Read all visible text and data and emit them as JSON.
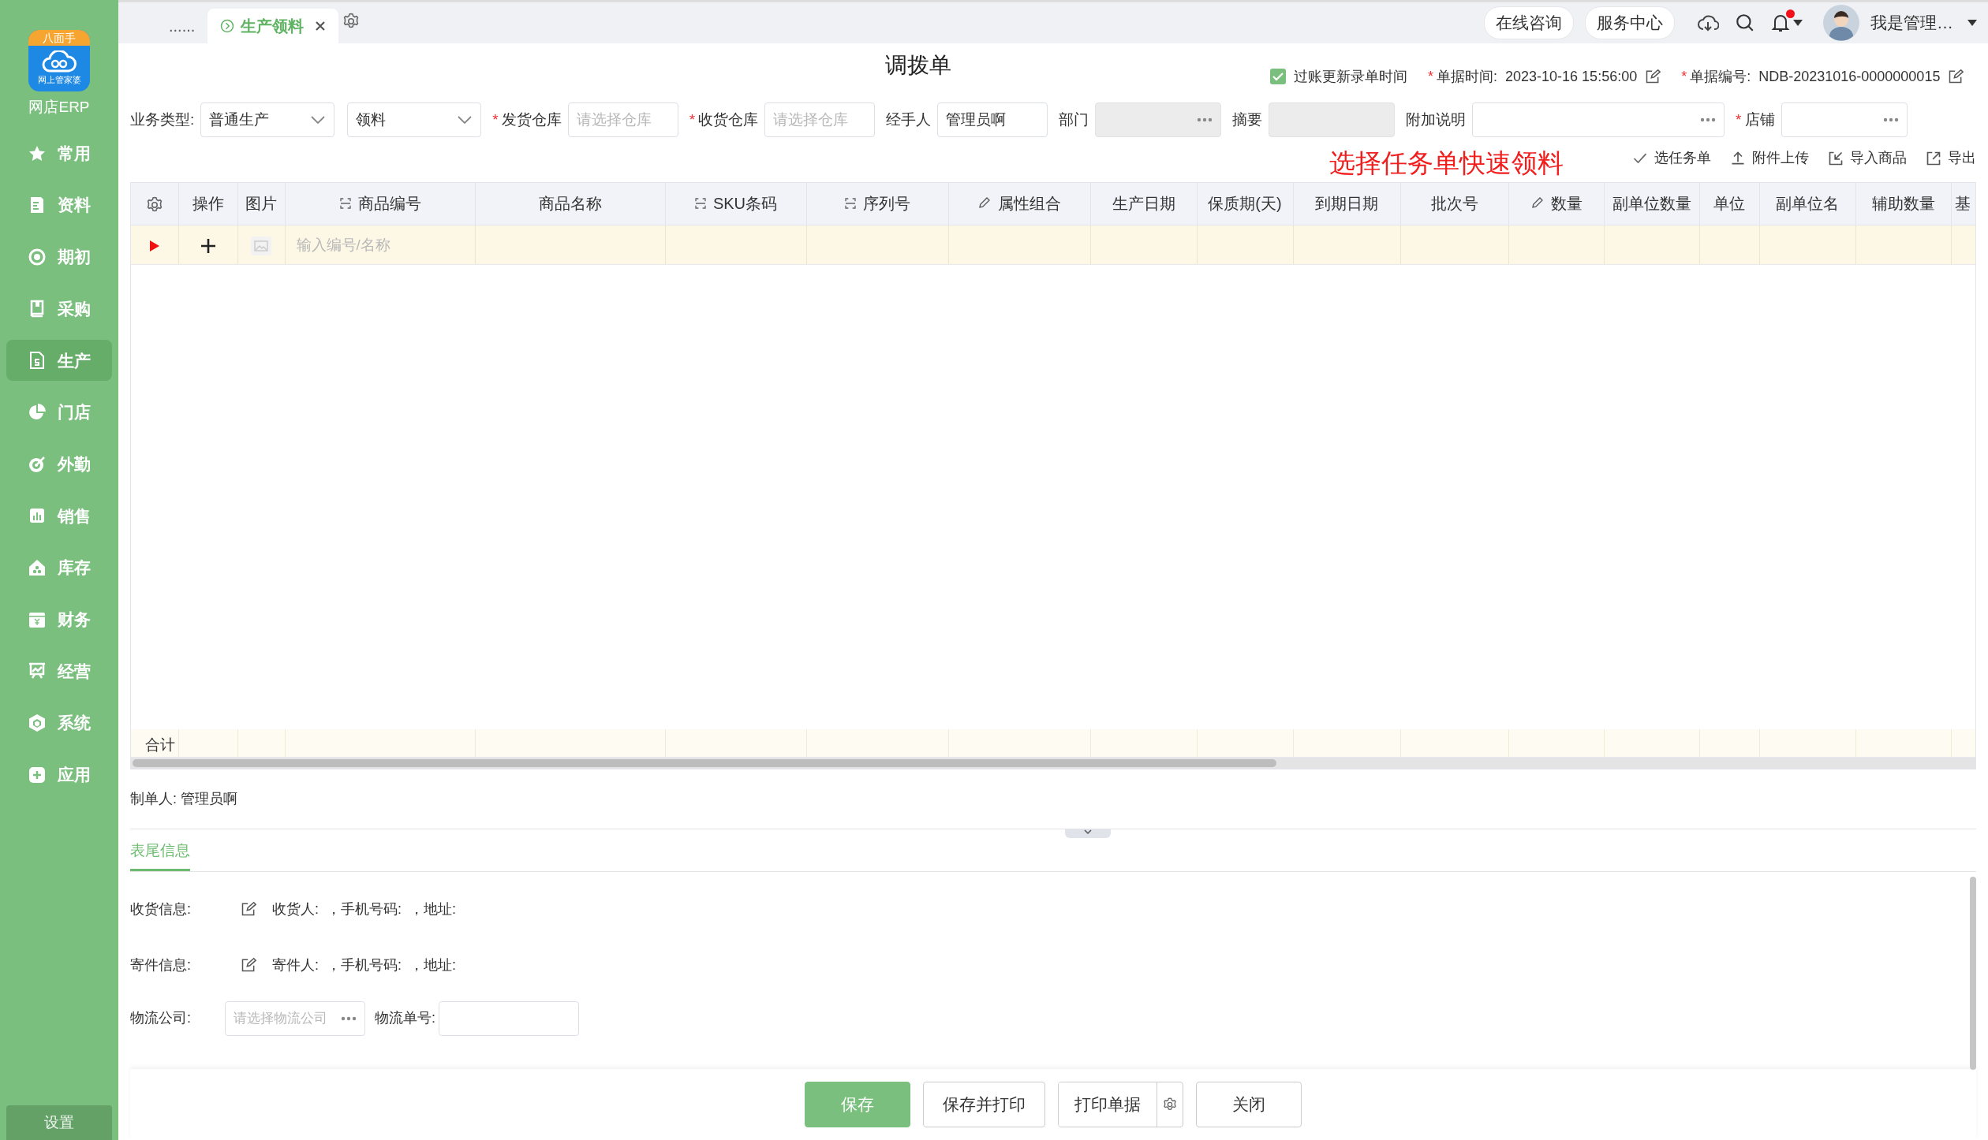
{
  "sidebar": {
    "logo_badge": "八面手",
    "logo_caption": "网上管家婆",
    "app_name": "网店ERP",
    "items": [
      {
        "label": "常用",
        "selected": false
      },
      {
        "label": "资料",
        "selected": false
      },
      {
        "label": "期初",
        "selected": false
      },
      {
        "label": "采购",
        "selected": false
      },
      {
        "label": "生产",
        "selected": true
      },
      {
        "label": "门店",
        "selected": false
      },
      {
        "label": "外勤",
        "selected": false
      },
      {
        "label": "销售",
        "selected": false
      },
      {
        "label": "库存",
        "selected": false
      },
      {
        "label": "财务",
        "selected": false
      },
      {
        "label": "经营",
        "selected": false
      },
      {
        "label": "系统",
        "selected": false
      },
      {
        "label": "应用",
        "selected": false
      }
    ],
    "settings": "设置"
  },
  "tabs": [
    {
      "label": "......",
      "selected": false
    },
    {
      "label": "生产领料",
      "selected": true
    }
  ],
  "header_links": [
    "在线咨询",
    "服务中心"
  ],
  "notifications": {
    "unread": true
  },
  "user": {
    "name": "我是管理…"
  },
  "form": {
    "title": "调拨单",
    "post_update": {
      "label": "过账更新录单时间",
      "checked": true
    },
    "meta": [
      {
        "required_mark": "*",
        "label": "单据时间:",
        "value": "2023-10-16 15:56:00"
      },
      {
        "required_mark": "*",
        "label": "单据编号:",
        "value": "NDB-20231016-0000000015"
      }
    ],
    "fields": [
      {
        "label": "业务类型:",
        "kind": "select",
        "value": "普通生产"
      },
      {
        "kind": "select",
        "value": "领料"
      },
      {
        "required_mark": "*",
        "label": "发货仓库",
        "kind": "input",
        "placeholder": "请选择仓库"
      },
      {
        "required_mark": "*",
        "label": "收货仓库",
        "kind": "input",
        "placeholder": "请选择仓库"
      },
      {
        "label": "经手人",
        "kind": "input",
        "value": "管理员啊"
      },
      {
        "label": "部门",
        "kind": "picker",
        "disabled": true
      },
      {
        "label": "摘要",
        "kind": "input",
        "disabled": true
      },
      {
        "label": "附加说明",
        "kind": "picker",
        "disabled": false
      },
      {
        "required_mark": "*",
        "label": "店铺",
        "kind": "picker",
        "disabled": false
      }
    ]
  },
  "toolbar": [
    "选任务单",
    "附件上传",
    "导入商品",
    "导出"
  ],
  "annotation": "选择任务单快速领料",
  "table": {
    "columns": [
      "",
      "操作",
      "图片",
      "商品编号",
      "商品名称",
      "SKU条码",
      "序列号",
      "属性组合",
      "生产日期",
      "保质期(天)",
      "到期日期",
      "批次号",
      "数量",
      "副单位数量",
      "单位",
      "副单位名",
      "辅助数量",
      "基"
    ],
    "rows": [
      {
        "current": true,
        "placeholder": "输入编号/名称"
      }
    ],
    "total_label": "合计"
  },
  "maker": "制单人: 管理员啊",
  "footer_tabs": [
    {
      "label": "表尾信息",
      "selected": true
    }
  ],
  "footer_info": [
    {
      "label": "收货信息:",
      "text": "收货人:  ，手机号码:  ，地址:"
    },
    {
      "label": "寄件信息:",
      "text": "寄件人:  ，手机号码:  ，地址:"
    }
  ],
  "logistics": {
    "company_label": "物流公司:",
    "company_placeholder": "请选择物流公司",
    "number_label": "物流单号:"
  },
  "buttons": [
    {
      "label": "保存",
      "kind": "primary"
    },
    {
      "label": "保存并打印",
      "kind": "default"
    },
    {
      "label": "打印单据",
      "kind": "split"
    },
    {
      "label": "关闭",
      "kind": "default"
    }
  ]
}
